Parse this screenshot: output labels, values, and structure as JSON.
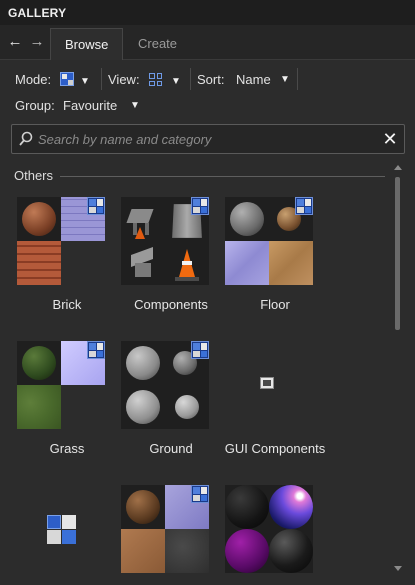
{
  "window": {
    "title": "GALLERY"
  },
  "nav": {
    "back_icon": "arrow-left-icon",
    "forward_icon": "arrow-right-icon"
  },
  "tabs": [
    {
      "label": "Browse",
      "active": true
    },
    {
      "label": "Create",
      "active": false
    }
  ],
  "options": {
    "mode_label": "Mode:",
    "view_label": "View:",
    "sort_label": "Sort:",
    "sort_value": "Name",
    "group_label": "Group:",
    "group_value": "Favourite"
  },
  "search": {
    "placeholder": "Search by name and category",
    "value": ""
  },
  "section": {
    "label": "Others"
  },
  "items": [
    {
      "label": "Brick"
    },
    {
      "label": "Components"
    },
    {
      "label": "Floor"
    },
    {
      "label": "Grass"
    },
    {
      "label": "Ground"
    },
    {
      "label": "GUI Components"
    }
  ],
  "colors": {
    "background": "#2c2c2c",
    "titlebar": "#1e1e1e",
    "accent_blue": "#3a70d8"
  }
}
